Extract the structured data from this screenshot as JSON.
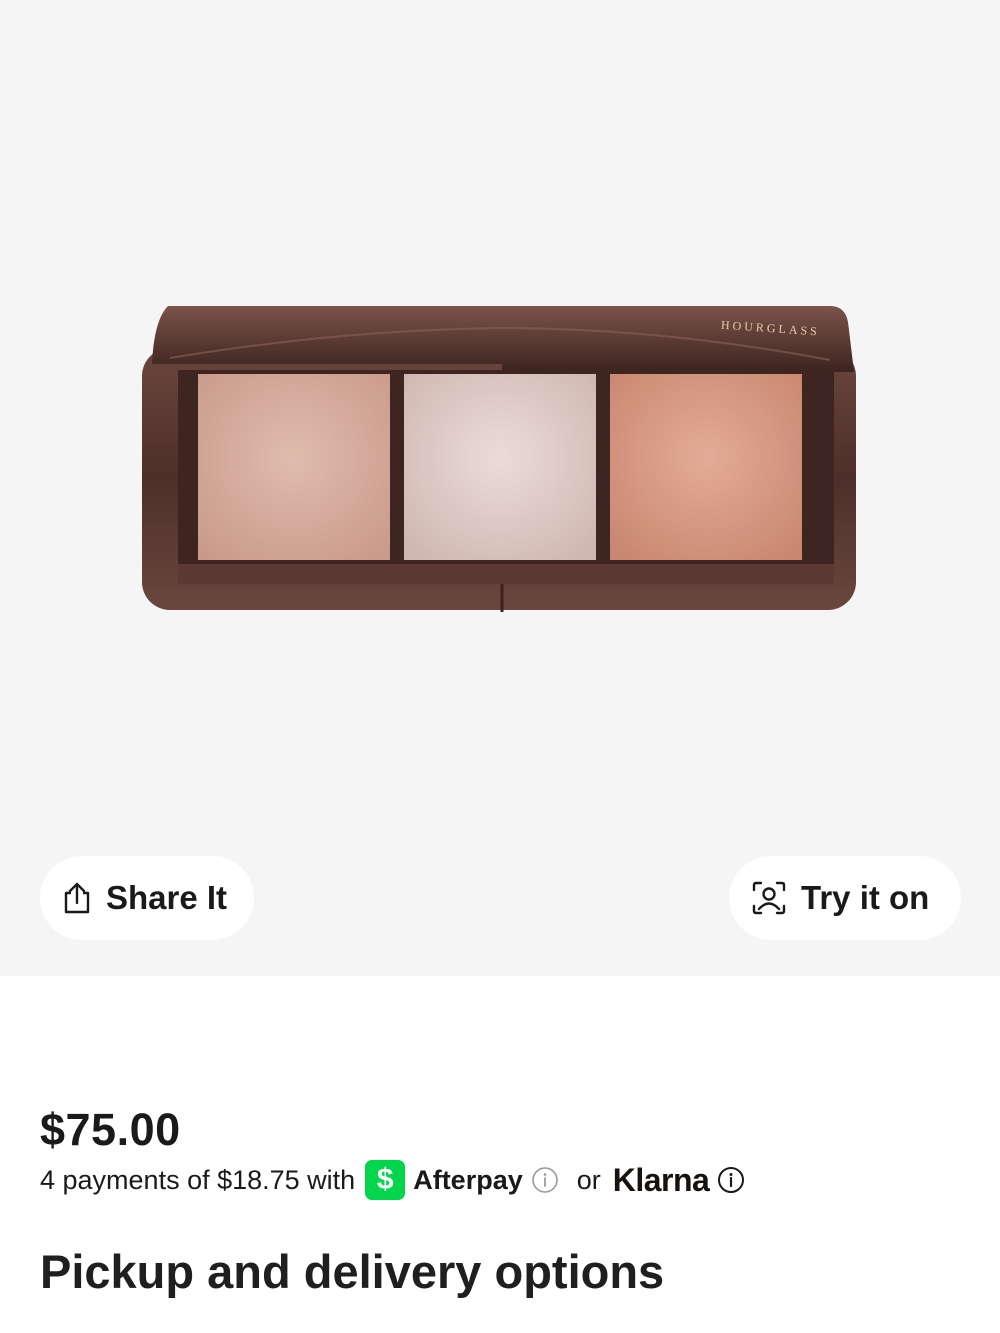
{
  "product": {
    "image_alt": "",
    "brand_text": "HOURGLASS",
    "share_label": "Share It",
    "try_on_label": "Try it on",
    "share_icon": "share-icon",
    "try_on_icon": "face-scan-icon"
  },
  "pricing": {
    "price": "$75.00",
    "installments_text": "4 payments of $18.75 with",
    "cashapp_symbol": "$",
    "afterpay_label": "Afterpay",
    "or_text": "or",
    "klarna_label": "Klarna"
  },
  "sections": {
    "pickup_title": "Pickup and delivery options"
  },
  "colors": {
    "hero_background": "#f5f5f5",
    "cashapp_green": "#00d54b",
    "compact_case": "#5a3a33",
    "pan_left": "#d6ab9c",
    "pan_middle": "#ddc8c4",
    "pan_right": "#d89b84"
  }
}
